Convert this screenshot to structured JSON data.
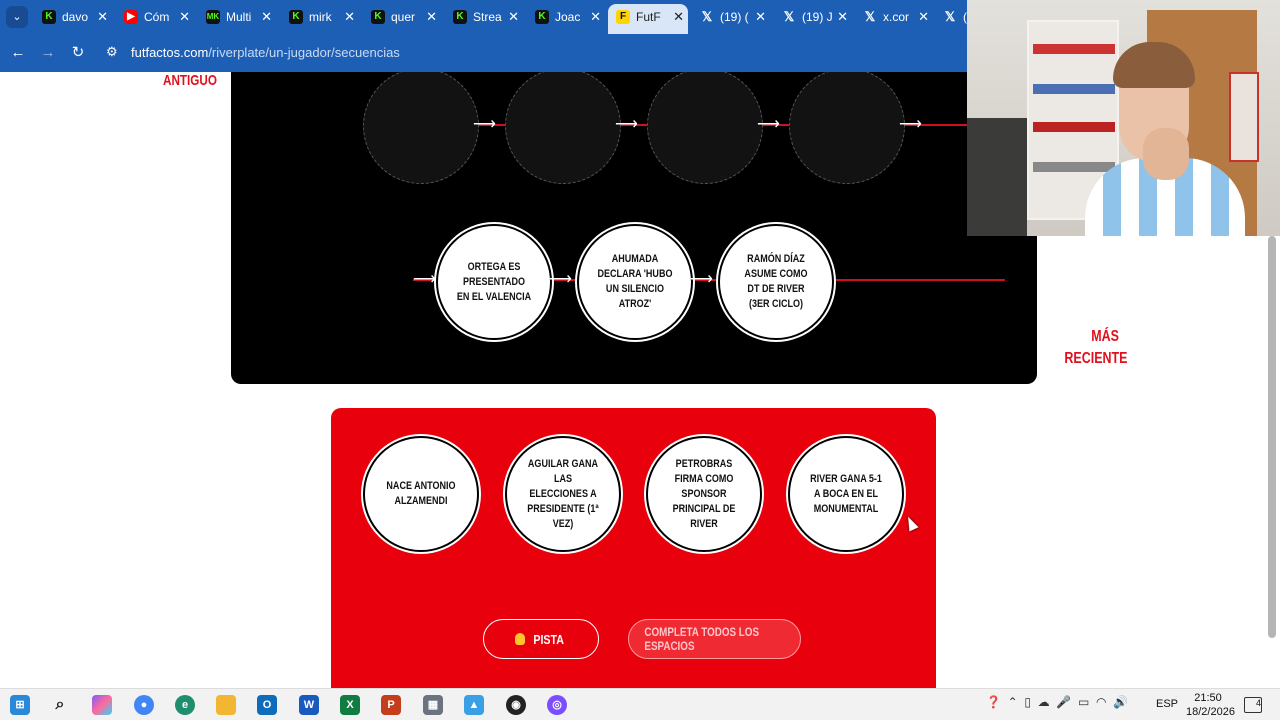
{
  "browser": {
    "tabs": [
      {
        "favicon": "kick",
        "title": "davo"
      },
      {
        "favicon": "youtube",
        "title": "Cóm"
      },
      {
        "favicon": "mk",
        "title": "Multi"
      },
      {
        "favicon": "kick",
        "title": "mirk"
      },
      {
        "favicon": "kick",
        "title": "quer"
      },
      {
        "favicon": "kick",
        "title": "Strea"
      },
      {
        "favicon": "kick",
        "title": "Joac"
      },
      {
        "favicon": "futfactos",
        "title": "FutF",
        "active": true
      },
      {
        "favicon": "x",
        "title": "(19) ("
      },
      {
        "favicon": "x",
        "title": "(19) J"
      },
      {
        "favicon": "x",
        "title": "x.cor"
      },
      {
        "favicon": "x",
        "title": "("
      }
    ],
    "url_host": "futfactos.com",
    "url_path": "/riverplate/un-jugador/secuencias"
  },
  "page": {
    "label_oldest": "ANTIGUO",
    "label_newest_1": "MÁS",
    "label_newest_2": "RECIENTE",
    "placed_events": [
      "ORTEGA ES PRESENTADO EN EL VALENCIA",
      "AHUMADA DECLARA 'HUBO UN SILENCIO ATROZ'",
      "RAMÓN DÍAZ ASUME COMO DT DE RIVER (3ER CICLO)"
    ],
    "available_cards": [
      "NACE ANTONIO ALZAMENDI",
      "AGUILAR GANA LAS ELECCIONES A PRESIDENTE (1ª VEZ)",
      "PETROBRAS FIRMA COMO SPONSOR PRINCIPAL DE RIVER",
      "RIVER GANA 5-1 A BOCA EN EL MONUMENTAL"
    ],
    "hint_button": "PISTA",
    "complete_button": "COMPLETA TODOS LOS ESPACIOS"
  },
  "taskbar": {
    "language": "ESP",
    "time": "21:50",
    "date": "18/2/2026",
    "notifications": "4"
  },
  "colors": {
    "accent_red": "#e8000c",
    "browser_blue": "#1e5fb6",
    "board_black": "#000000"
  }
}
